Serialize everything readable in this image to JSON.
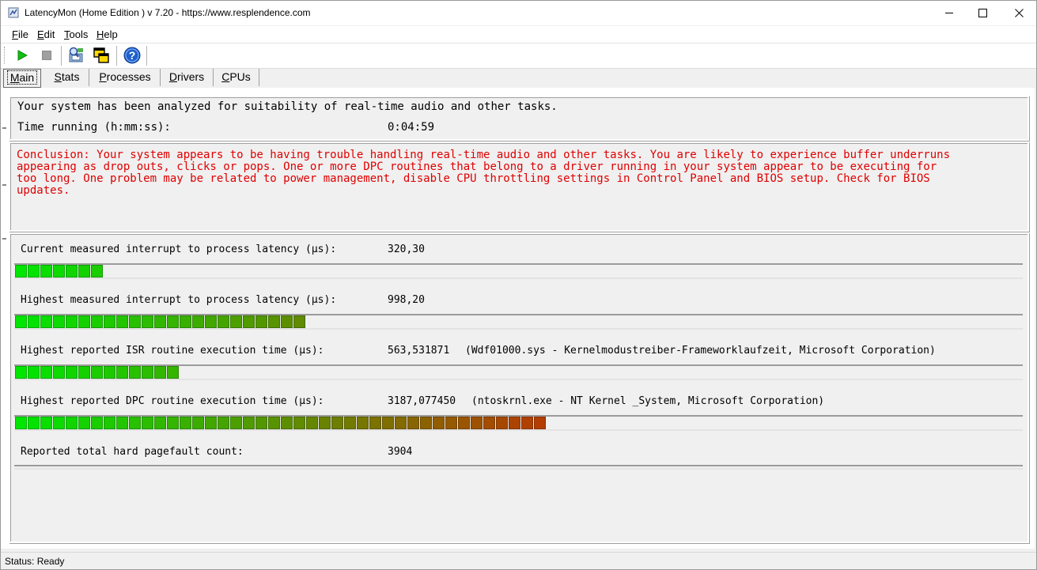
{
  "window": {
    "title": "LatencyMon  (Home Edition )  v 7.20 - https://www.resplendence.com"
  },
  "menu": {
    "items": [
      {
        "label": "File",
        "u": "F",
        "rest": "ile"
      },
      {
        "label": "Edit",
        "u": "E",
        "rest": "dit"
      },
      {
        "label": "Tools",
        "u": "T",
        "rest": "ools"
      },
      {
        "label": "Help",
        "u": "H",
        "rest": "elp"
      }
    ]
  },
  "toolbar": {
    "icons": [
      "play-icon",
      "stop-icon",
      "analyze-icon",
      "windows-icon",
      "help-icon"
    ]
  },
  "tabs": [
    {
      "label": "Main",
      "u": "M",
      "rest": "ain",
      "active": true
    },
    {
      "label": "Stats",
      "u": "S",
      "rest": "tats",
      "active": false
    },
    {
      "label": "Processes",
      "u": "P",
      "rest": "rocesses",
      "active": false
    },
    {
      "label": "Drivers",
      "u": "D",
      "rest": "rivers",
      "active": false
    },
    {
      "label": "CPUs",
      "u": "C",
      "rest": "PUs",
      "active": false
    }
  ],
  "summary": {
    "headline": "Your system has been analyzed for suitability of real-time audio and other tasks.",
    "time_label": "Time running (h:mm:ss):",
    "time_value": "0:04:59"
  },
  "conclusion": {
    "line1": "Conclusion: Your system appears to be having trouble handling real-time audio and other tasks. You are likely to experience buffer underruns",
    "line2": "appearing as drop outs, clicks or pops. One or more DPC routines that belong to a driver running in your system appear to be executing for",
    "line3": "too long. One problem may be related to power management, disable CPU throttling settings in Control Panel and BIOS setup. Check for BIOS",
    "line4": "updates."
  },
  "metrics": [
    {
      "label": "Current measured interrupt to process latency (µs):",
      "value": "320,30",
      "detail": "",
      "segments": 7
    },
    {
      "label": "Highest measured interrupt to process latency (µs):",
      "value": "998,20",
      "detail": "",
      "segments": 23
    },
    {
      "label": "Highest reported ISR routine execution time (µs):",
      "value": "563,531871",
      "detail": "(Wdf01000.sys - Kernelmodustreiber-Frameworklaufzeit, Microsoft Corporation)",
      "segments": 13
    },
    {
      "label": "Highest reported DPC routine execution time (µs):",
      "value": "3187,077450",
      "detail": "(ntoskrnl.exe - NT Kernel _System, Microsoft Corporation)",
      "segments": 42
    },
    {
      "label": "Reported total hard pagefault count:",
      "value": "3904",
      "detail": "",
      "segments": 0
    }
  ],
  "status": {
    "text": "Status: Ready"
  },
  "colors": {
    "conclusion_text": "#e00000",
    "bar_green": "#00e600",
    "bar_red": "#b43c00"
  }
}
